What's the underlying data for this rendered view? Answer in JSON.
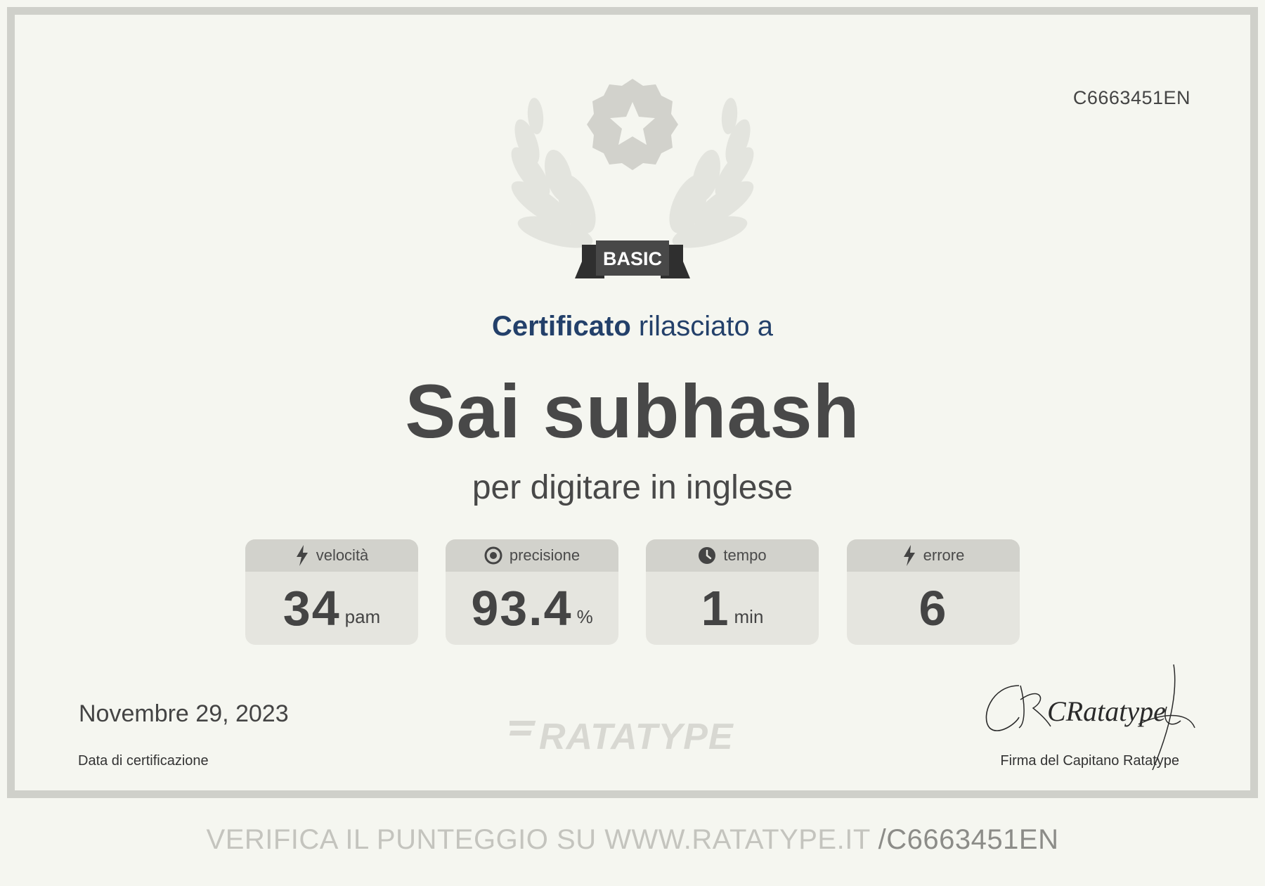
{
  "certificate": {
    "id": "C6663451EN",
    "level": "BASIC",
    "headline_strong": "Certificato",
    "headline_rest": " rilasciato a",
    "recipient": "Sai subhash",
    "subtitle": "per digitare in inglese"
  },
  "stats": [
    {
      "icon": "lightning-icon",
      "label": "velocità",
      "value": "34",
      "unit": "pam"
    },
    {
      "icon": "target-icon",
      "label": "precisione",
      "value": "93.4",
      "unit": "%"
    },
    {
      "icon": "clock-icon",
      "label": "tempo",
      "value": "1",
      "unit": "min"
    },
    {
      "icon": "lightning-icon",
      "label": "errore",
      "value": "6",
      "unit": ""
    }
  ],
  "footer": {
    "date": "Novembre 29, 2023",
    "date_label": "Data di certificazione",
    "brand": "RATATYPE",
    "signature_label": "Firma del Capitano Ratatype",
    "signature_text": "CRatatype"
  },
  "verify": {
    "text": "VERIFICA IL PUNTEGGIO SU WWW.RATATYPE.IT ",
    "code": "/C6663451EN"
  },
  "colors": {
    "background": "#f5f6f0",
    "frame": "#cfd0ca",
    "headline": "#23406a",
    "text": "#484848",
    "ribbon": "#484848"
  }
}
